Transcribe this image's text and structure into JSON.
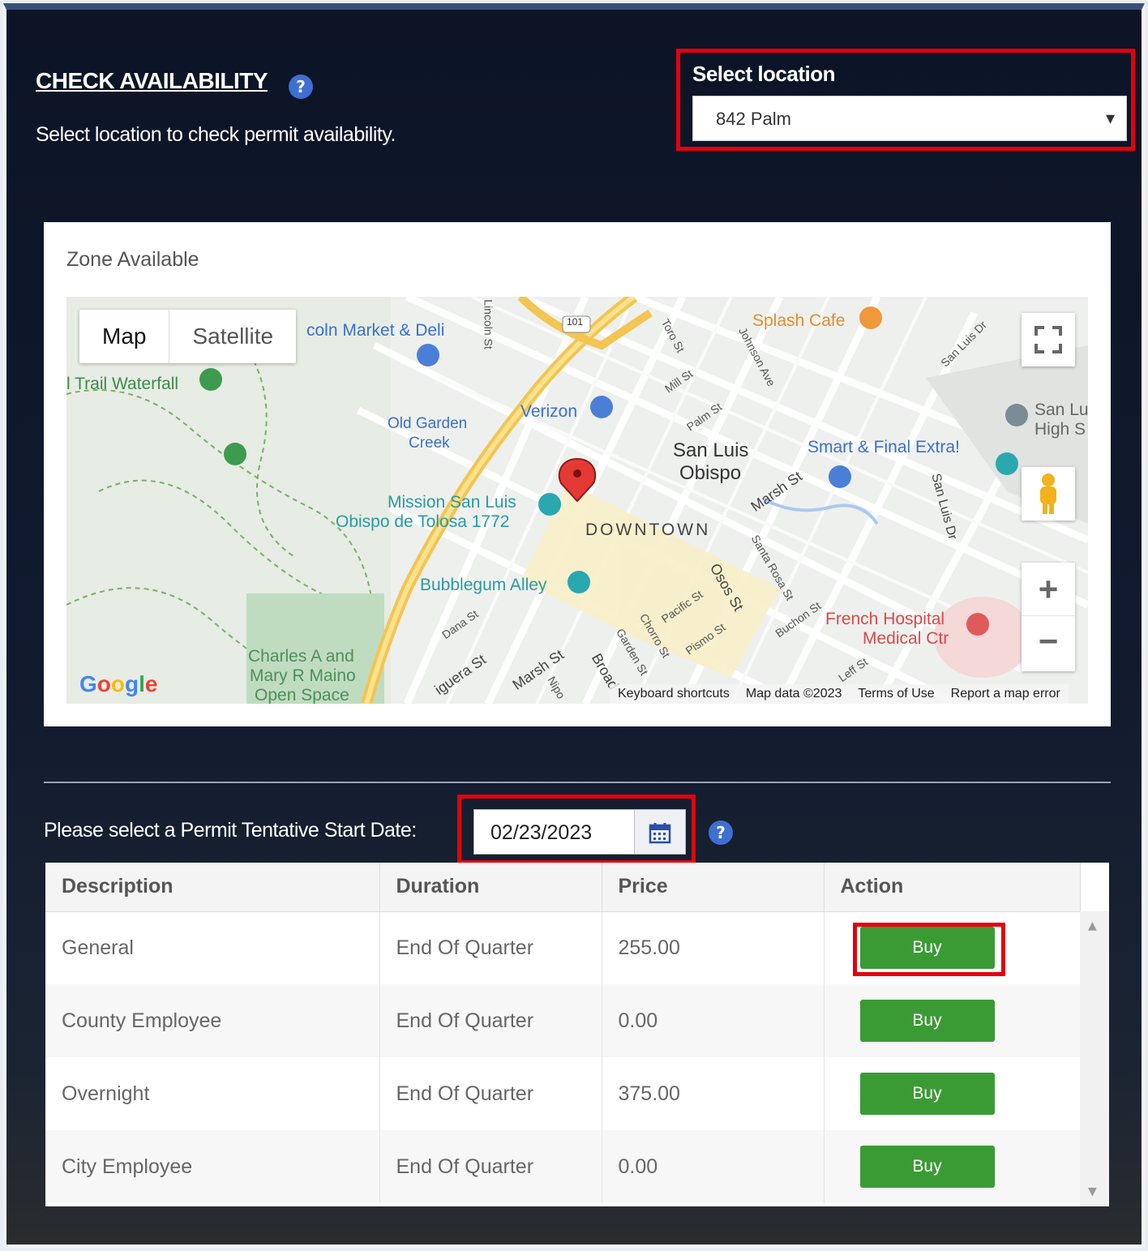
{
  "header": {
    "title": "CHECK AVAILABILITY",
    "help": "?",
    "subtitle": "Select location to check permit availability."
  },
  "location": {
    "label": "Select location",
    "selected": "842 Palm",
    "chevron": "▾"
  },
  "map": {
    "card_title": "Zone Available",
    "toggle": {
      "map": "Map",
      "satellite": "Satellite"
    },
    "labels": {
      "lincoln_market": "coln Market & Deli",
      "trail_waterfall": "l Trail Waterfall",
      "old_garden_creek_1": "Old Garden",
      "old_garden_creek_2": "Creek",
      "verizon": "Verizon",
      "splash_cafe": "Splash Cafe",
      "slo_1": "San Luis",
      "slo_2": "Obispo",
      "smart_final": "Smart & Final Extra!",
      "slo_high_1": "San Lu",
      "slo_high_2": "High S",
      "mission_1": "Mission San Luis",
      "mission_2": "Obispo de Tolosa 1772",
      "downtown": "DOWNTOWN",
      "bubblegum": "Bubblegum Alley",
      "french_1": "French Hospital",
      "french_2": "Medical Ctr",
      "charles_1": "Charles A and",
      "charles_2": "Mary R Maino",
      "charles_3": "Open Space",
      "marsh_st": "Marsh St",
      "higuera_st": "iguera St",
      "marsh_st_2": "Marsh St",
      "broad": "Broad",
      "osos_st": "Osos St",
      "san_luis_dr": "San Luis Dr",
      "toro_st": "Toro St",
      "johnson_ave": "Johnson Ave",
      "mill_st": "Mill St",
      "palm_st": "Palm St",
      "lincoln_st": "Lincoln St",
      "dana_st": "Dana St",
      "santa_rosa": "Santa Rosa St",
      "pacific_st": "Pacific St",
      "pismo_st": "Pismo St",
      "buchon_st": "Buchon St",
      "chorro_st": "Chorro St",
      "garden_st": "Garden St",
      "leff_st": "Leff St",
      "nipomo": "Nipo",
      "san_luis_dr_2": "San Luis Dr",
      "hwy": "101",
      "google": "Google"
    },
    "footer": {
      "shortcuts": "Keyboard shortcuts",
      "data": "Map data ©2023",
      "terms": "Terms of Use",
      "report": "Report a map error"
    },
    "controls": {
      "zoom_in": "+",
      "zoom_out": "−"
    }
  },
  "date": {
    "label": "Please select a Permit Tentative Start Date:",
    "value": "02/23/2023"
  },
  "table": {
    "headers": [
      "Description",
      "Duration",
      "Price",
      "Action"
    ],
    "rows": [
      {
        "description": "General",
        "duration": "End Of Quarter",
        "price": "255.00",
        "action": "Buy"
      },
      {
        "description": "County Employee",
        "duration": "End Of Quarter",
        "price": "0.00",
        "action": "Buy"
      },
      {
        "description": "Overnight",
        "duration": "End Of Quarter",
        "price": "375.00",
        "action": "Buy"
      },
      {
        "description": "City Employee",
        "duration": "End Of Quarter",
        "price": "0.00",
        "action": "Buy"
      }
    ]
  },
  "colors": {
    "highlight": "#e3000b",
    "buy_button": "#3a9b35",
    "help_icon": "#3e6fd1"
  }
}
